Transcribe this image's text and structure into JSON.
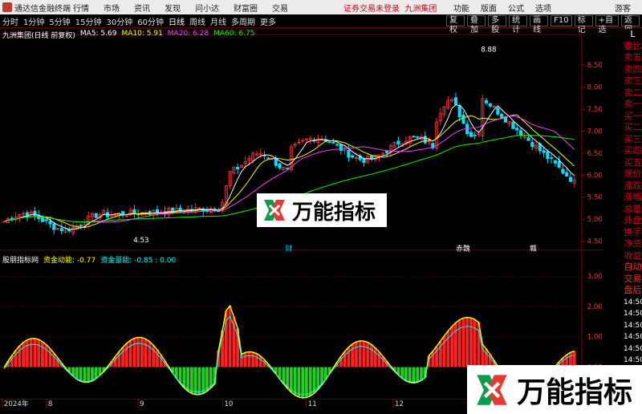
{
  "topbar": {
    "app_name": "通达信金融终端",
    "menu": [
      "行情",
      "市场",
      "资讯",
      "发现",
      "问小达",
      "财富圈",
      "交易"
    ],
    "notice": "证券交易未登录",
    "stock": "九洲集团",
    "right_menu": [
      "功能",
      "版面",
      "公式",
      "选项"
    ],
    "guest": "游客"
  },
  "toolbar": {
    "tabs": [
      "分时",
      "1分钟",
      "5分钟",
      "15分钟",
      "30分钟",
      "60分钟",
      "日线",
      "周线",
      "月线",
      "多周期",
      "更多"
    ],
    "active_tab": "日线",
    "buttons": [
      "复权",
      "叠加",
      "多股",
      "统计",
      "画线",
      "F10",
      "标记",
      "+自选",
      "返回"
    ]
  },
  "legend": {
    "title": "九洲集团(日线 前复权)",
    "ma5": "MA5: 5.69",
    "ma10": "MA10: 5.91",
    "ma20": "MA20: 6.28",
    "ma60": "MA60: 6.75"
  },
  "indicator_legend": {
    "title": "股朋指标网",
    "fund_momentum": "资金动能: -0.77",
    "fund_volume": "资金量能: -0.85 : 0.00"
  },
  "annotations": {
    "high": "8.88",
    "low": "4.53",
    "marker1": "财",
    "marker2": "赤魏",
    "marker3": "赣"
  },
  "axis": {
    "price_ticks": [
      "8.50",
      "8.00",
      "7.50",
      "7.00",
      "6.50",
      "6.00",
      "5.50",
      "5.00",
      "4.50"
    ],
    "ind_ticks": [
      "3.00",
      "2.00",
      "1.00",
      "0.00"
    ],
    "date_labels": [
      "2024年",
      "8",
      "9",
      "10",
      "11",
      "12"
    ]
  },
  "sidebar": {
    "top": "L",
    "items": [
      "委比",
      "卖五",
      "卖四",
      "卖三",
      "卖二",
      "卖一",
      "买一",
      "买二",
      "买三",
      "买四",
      "买五",
      "现价",
      "涨跌",
      "涨幅",
      "总量",
      "外盘",
      "换手",
      "净资",
      "收益",
      "自动",
      "交易",
      "盘后",
      "14:50",
      "14:50",
      "14:50",
      "14:50",
      "14:50",
      "14:50",
      "14:50"
    ]
  },
  "watermark": {
    "text": "万能指标"
  },
  "colors": {
    "up": "#ff3030",
    "down": "#00e0ff",
    "ma5": "#ffffff",
    "ma10": "#ffff00",
    "ma20": "#ff40ff",
    "ma60": "#00ff00",
    "red_bar": "#ff2020",
    "green_bar": "#20d020"
  }
}
